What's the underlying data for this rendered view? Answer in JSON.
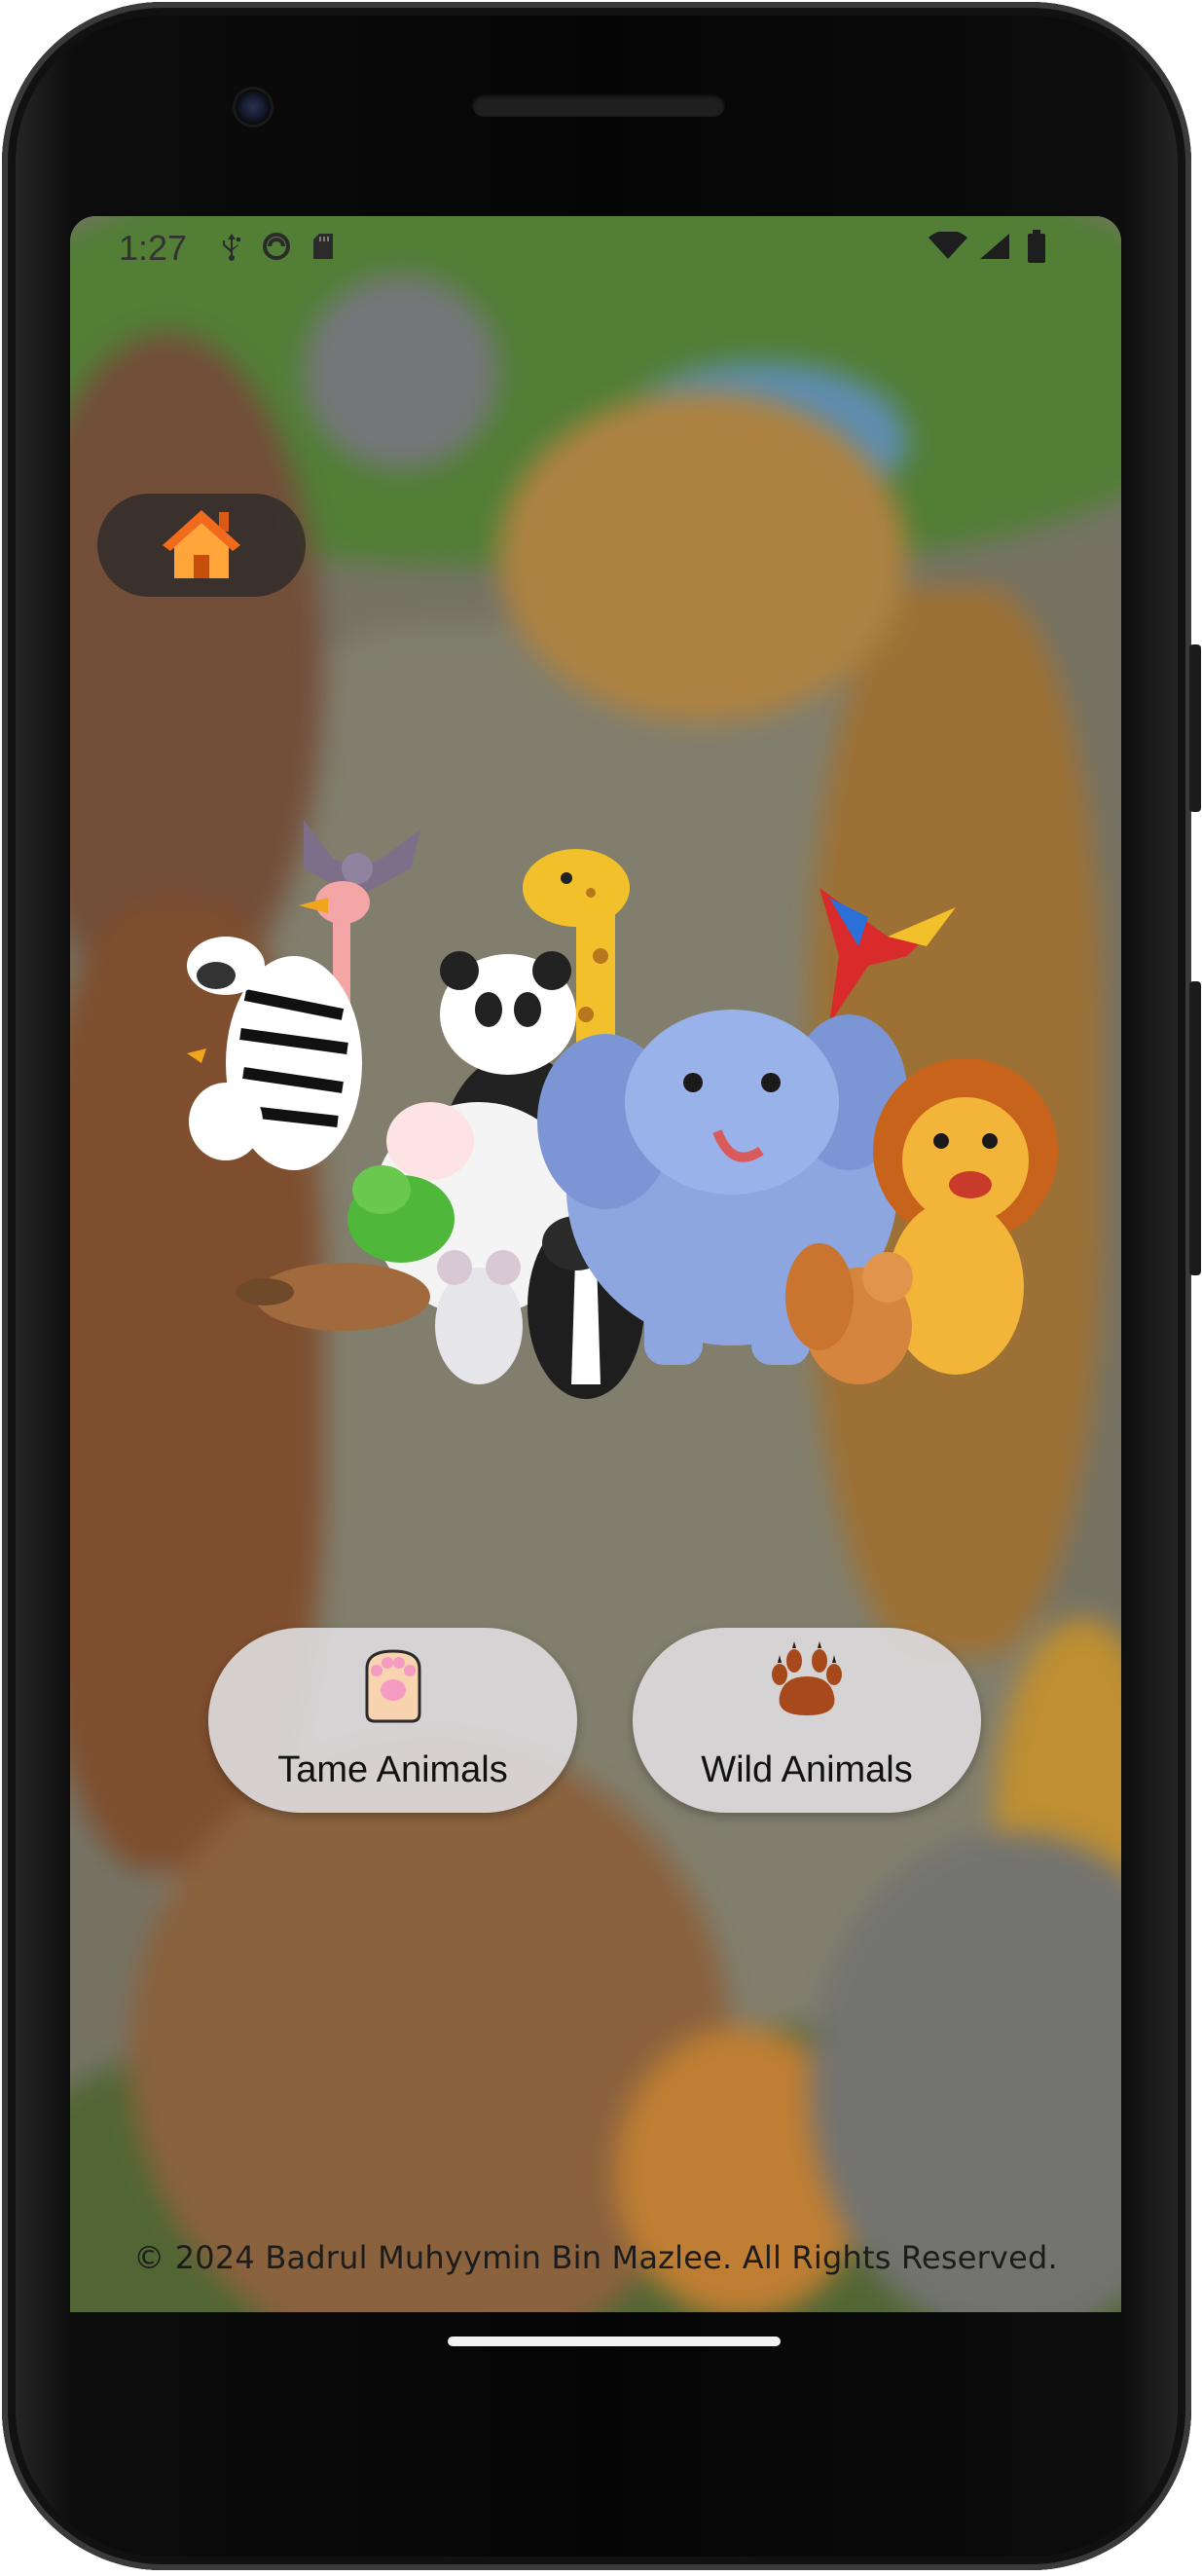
{
  "status_bar": {
    "time": "1:27",
    "left_icons": [
      "usb-debug-icon",
      "sync-icon",
      "sd-card-icon"
    ],
    "right_icons": [
      "wifi-icon",
      "signal-icon",
      "battery-icon"
    ]
  },
  "home_button": {
    "icon": "home-icon"
  },
  "illustration": {
    "subject": "group of cartoon animals"
  },
  "categories": [
    {
      "label": "Tame Animals",
      "icon": "paw-icon"
    },
    {
      "label": "Wild Animals",
      "icon": "bear-paw-icon"
    }
  ],
  "footer": {
    "text": "© 2024 Badrul Muhyymin Bin Mazlee. All Rights Reserved."
  },
  "colors": {
    "home_icon": "#ff8a1f",
    "button_bg": "#dcdadc",
    "footer_text": "#1c1c1c"
  }
}
